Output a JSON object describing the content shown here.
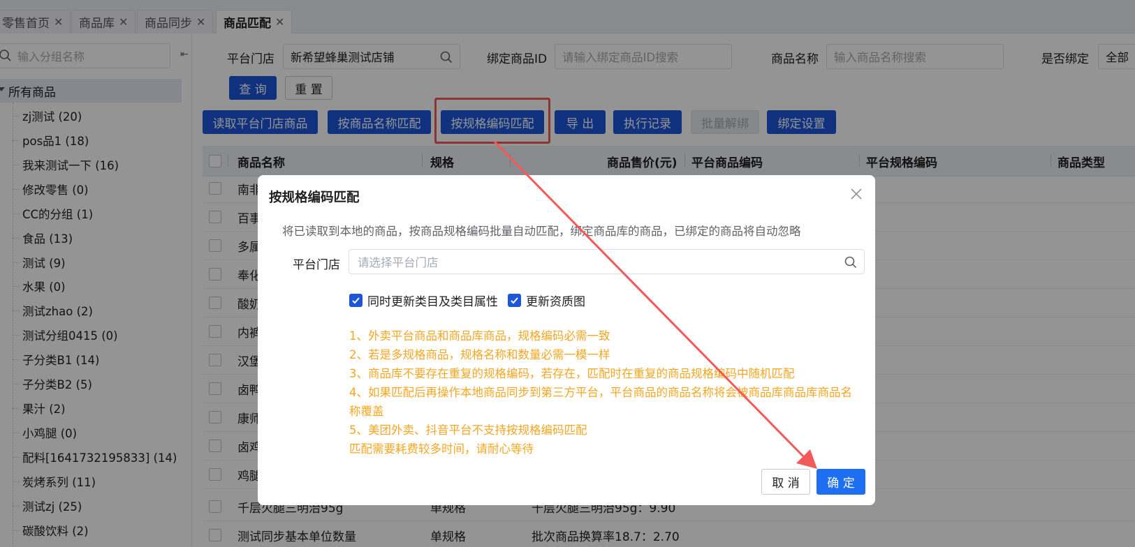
{
  "tabs": [
    {
      "label": "零售首页"
    },
    {
      "label": "商品库"
    },
    {
      "label": "商品同步"
    },
    {
      "label": "商品匹配"
    }
  ],
  "sidebar": {
    "search_placeholder": "输入分组名称",
    "root_label": "所有商品",
    "items": [
      {
        "label": "zj测试 (20)"
      },
      {
        "label": "pos品1 (18)"
      },
      {
        "label": "我来测试一下 (16)"
      },
      {
        "label": "修改零售 (0)"
      },
      {
        "label": "CC的分组 (1)"
      },
      {
        "label": "食品 (13)"
      },
      {
        "label": "测试 (9)"
      },
      {
        "label": "水果 (0)"
      },
      {
        "label": "测试zhao (2)"
      },
      {
        "label": "测试分组0415 (0)"
      },
      {
        "label": "子分类B1 (14)"
      },
      {
        "label": "子分类B2 (5)"
      },
      {
        "label": "果汁 (2)"
      },
      {
        "label": "小鸡腿 (0)"
      },
      {
        "label": "配料[1641732195833] (14)"
      },
      {
        "label": "炭烤系列 (11)"
      },
      {
        "label": "测试zj (25)"
      },
      {
        "label": "碳酸饮料 (2)"
      }
    ]
  },
  "filters": {
    "store_label": "平台门店",
    "store_value": "新希望蜂巢测试店铺",
    "bind_id_label": "绑定商品ID",
    "bind_id_placeholder": "请输入绑定商品ID搜索",
    "name_label": "商品名称",
    "name_placeholder": "输入商品名称搜索",
    "is_bound_label": "是否绑定",
    "is_bound_value": "全部",
    "query_button": "查 询",
    "reset_button": "重 置"
  },
  "toolbar": {
    "read_store": "读取平台门店商品",
    "match_by_name": "按商品名称匹配",
    "match_by_spec": "按规格编码匹配",
    "export": "导 出",
    "exec_log": "执行记录",
    "batch_unbind": "批量解绑",
    "bind_settings": "绑定设置"
  },
  "table": {
    "headers": [
      "商品名称",
      "规格",
      "商品售价(元)",
      "平台商品编码",
      "平台规格编码",
      "商品类型"
    ],
    "rows": [
      {
        "name": "南非",
        "spec": "",
        "price": ""
      },
      {
        "name": "百事",
        "spec": "",
        "price": ""
      },
      {
        "name": "多属",
        "spec": "",
        "price": ""
      },
      {
        "name": "奉化",
        "spec": "",
        "price": ""
      },
      {
        "name": "酸奶",
        "spec": "",
        "price": ""
      },
      {
        "name": "内裤",
        "spec": "",
        "price": ""
      },
      {
        "name": "汉堡",
        "spec": "",
        "price": ""
      },
      {
        "name": "卤鸭",
        "spec": "",
        "price": ""
      },
      {
        "name": "康师",
        "spec": "",
        "price": ""
      },
      {
        "name": "卤鸡",
        "spec": "",
        "price": ""
      },
      {
        "name": "鸡腿",
        "spec": "",
        "price": ""
      },
      {
        "name": "千层火腿三明治95g",
        "spec": "单规格",
        "price": "千层火腿三明治95g：9.90"
      },
      {
        "name": "测试同步基本单位数量",
        "spec": "单规格",
        "price": "批次商品换算率18.7：2.70"
      }
    ]
  },
  "dialog": {
    "title": "按规格编码匹配",
    "description": "将已读取到本地的商品，按商品规格编码批量自动匹配，绑定商品库的商品，已绑定的商品将自动忽略",
    "store_label": "平台门店",
    "store_placeholder": "请选择平台门店",
    "checkbox_update_category": "同时更新类目及类目属性",
    "checkbox_update_image": "更新资质图",
    "notes": [
      "1、外卖平台商品和商品库商品，规格编码必需一致",
      "2、若是多规格商品，规格名称和数量必需一模一样",
      "3、商品库不要存在重复的规格编码，若存在，匹配时在重复的商品规格编码中随机匹配",
      "4、如果匹配后再操作本地商品同步到第三方平台，平台商品的商品名称将会被商品库商品库商品名称覆盖",
      "5、美团外卖、抖音平台不支持按规格编码匹配",
      "匹配需要耗费较多时间，请耐心等待"
    ],
    "cancel_button": "取 消",
    "ok_button": "确 定"
  },
  "colors": {
    "primary": "#1d56d9",
    "ok": "#1d6ef0",
    "notes": "#f5a623",
    "annotation": "#f25a5a"
  }
}
